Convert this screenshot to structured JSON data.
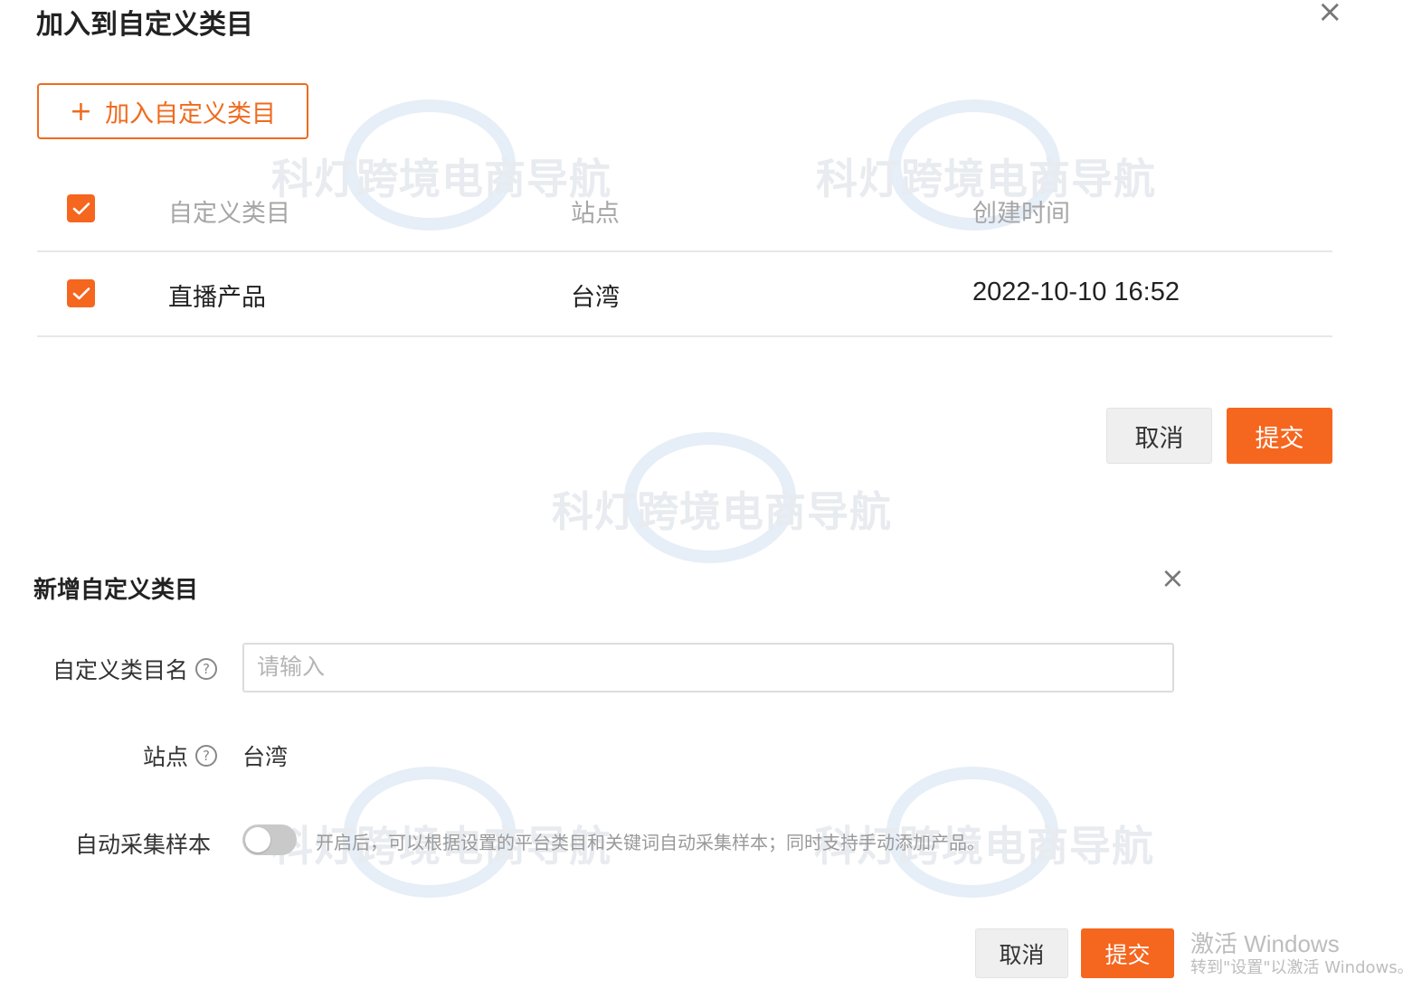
{
  "watermark_text": "科灯跨境电商导航",
  "dialog_add": {
    "title": "加入到自定义类目",
    "close_glyph": "×",
    "add_button": {
      "icon": "plus-icon",
      "label": "加入自定义类目"
    },
    "table": {
      "headers": [
        "自定义类目",
        "站点",
        "创建时间"
      ],
      "rows": [
        {
          "category": "直播产品",
          "site": "台湾",
          "created": "2022-10-10 16:52",
          "checked": true
        }
      ]
    },
    "cancel_label": "取消",
    "submit_label": "提交"
  },
  "dialog_new": {
    "title": "新增自定义类目",
    "close_glyph": "×",
    "name_label": "自定义类目名",
    "name_placeholder": "请输入",
    "name_value": "",
    "site_label": "站点",
    "site_value": "台湾",
    "auto_label": "自动采集样本",
    "auto_enabled": false,
    "auto_hint": "开启后，可以根据设置的平台类目和关键词自动采集样本；同时支持手动添加产品。",
    "cancel_label": "取消",
    "submit_label": "提交"
  },
  "os_notice": {
    "line1": "激活 Windows",
    "line2": "转到\"设置\"以激活 Windows。"
  },
  "colors": {
    "accent": "#f5661f",
    "accent_border": "#f06a1e",
    "muted_text": "#a6a6a6"
  }
}
